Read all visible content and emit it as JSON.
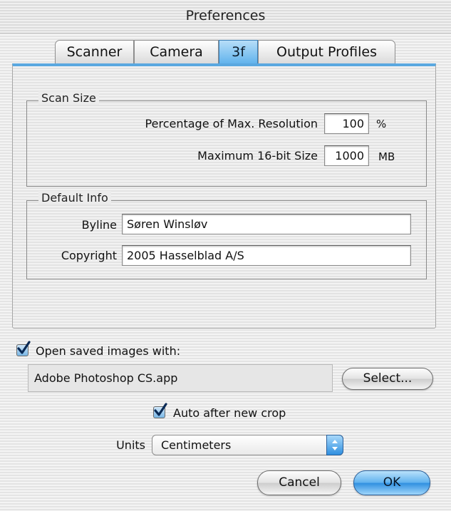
{
  "window": {
    "title": "Preferences"
  },
  "tabs": [
    {
      "label": "Scanner",
      "active": false
    },
    {
      "label": "Camera",
      "active": false
    },
    {
      "label": "3f",
      "active": true
    },
    {
      "label": "Output Profiles",
      "active": false
    }
  ],
  "scan_size": {
    "group_label": "Scan Size",
    "percentage_label": "Percentage of Max. Resolution",
    "percentage_value": "100",
    "percentage_unit": "%",
    "max_size_label": "Maximum 16-bit Size",
    "max_size_value": "1000",
    "max_size_unit": "MB"
  },
  "default_info": {
    "group_label": "Default Info",
    "byline_label": "Byline",
    "byline_value": "Søren Winsløv",
    "copyright_label": "Copyright",
    "copyright_value": "2005 Hasselblad A/S"
  },
  "open_saved": {
    "checked": true,
    "label": "Open saved images with:",
    "app_name": "Adobe Photoshop CS.app",
    "select_label": "Select..."
  },
  "auto_crop": {
    "checked": true,
    "label": "Auto after new crop"
  },
  "units": {
    "label": "Units",
    "selected": "Centimeters"
  },
  "buttons": {
    "cancel": "Cancel",
    "ok": "OK"
  },
  "colors": {
    "accent": "#3d9be9",
    "tab_active": "#5fb2ec"
  }
}
